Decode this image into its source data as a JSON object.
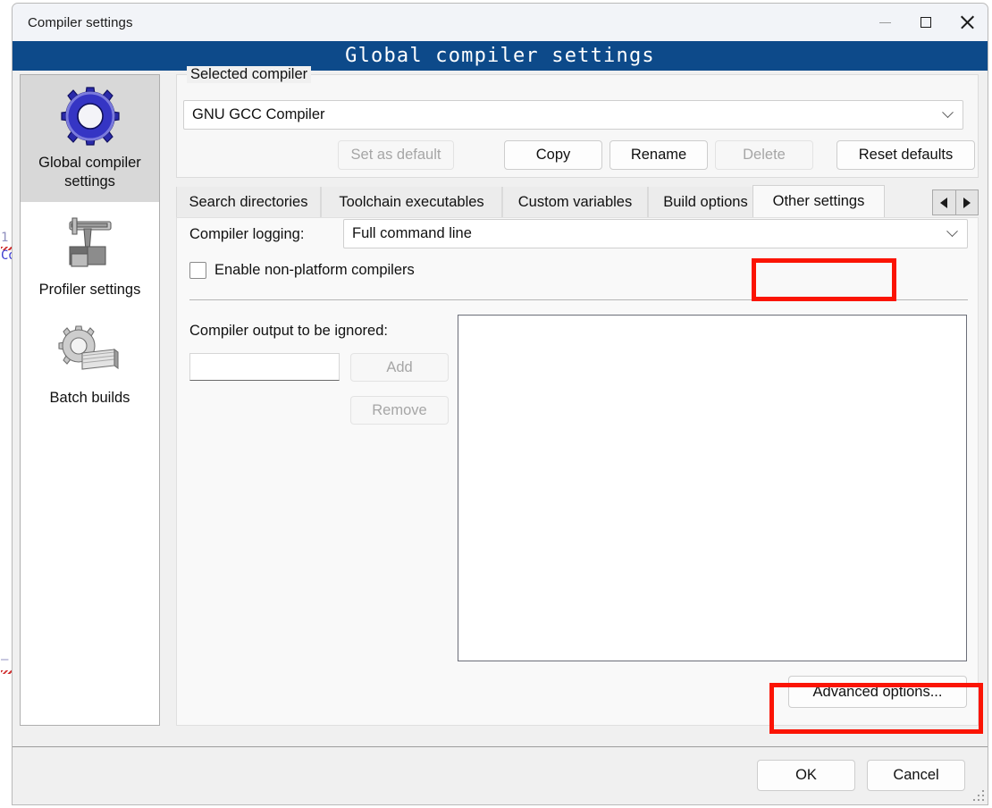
{
  "background_editor": {
    "line_number": "1",
    "code_fragment": "Co"
  },
  "window": {
    "title": "Compiler settings",
    "banner": "Global compiler settings",
    "controls": {
      "minimize": "minimize-icon",
      "maximize": "maximize-icon",
      "close": "close-icon"
    }
  },
  "sidebar": {
    "items": [
      {
        "label": "Global compiler settings",
        "icon": "blue-gear-icon",
        "selected": true
      },
      {
        "label": "Profiler settings",
        "icon": "caliper-blocks-icon",
        "selected": false
      },
      {
        "label": "Batch builds",
        "icon": "gear-stack-icon",
        "selected": false
      }
    ]
  },
  "selected_compiler": {
    "legend": "Selected compiler",
    "combo_value": "GNU GCC Compiler",
    "combo_icon": "chevron-down-icon",
    "buttons": [
      {
        "label": "Set as default",
        "disabled": true
      },
      {
        "label": "Copy",
        "disabled": false
      },
      {
        "label": "Rename",
        "disabled": false
      },
      {
        "label": "Delete",
        "disabled": true
      },
      {
        "label": "Reset defaults",
        "disabled": false
      }
    ]
  },
  "tabs": {
    "items": [
      {
        "label": "Search directories",
        "active": false
      },
      {
        "label": "Toolchain executables",
        "active": false
      },
      {
        "label": "Custom variables",
        "active": false
      },
      {
        "label": "Build options",
        "active": false
      },
      {
        "label": "Other settings",
        "active": true
      }
    ],
    "scroll_left_icon": "triangle-left-icon",
    "scroll_right_icon": "triangle-right-icon"
  },
  "other_settings": {
    "logging_label": "Compiler logging:",
    "logging_value": "Full command line",
    "logging_icon": "chevron-down-icon",
    "enable_non_platform_label": "Enable non-platform compilers",
    "enable_non_platform_checked": false,
    "ignored_label": "Compiler output to be ignored:",
    "ignored_input_value": "",
    "ignored_input_placeholder": "",
    "add_label": "Add",
    "add_disabled": true,
    "remove_label": "Remove",
    "remove_disabled": true,
    "ignored_list_items": [],
    "advanced_label": "Advanced options..."
  },
  "footer": {
    "ok_label": "OK",
    "cancel_label": "Cancel",
    "grip_icon": "resize-grip-icon"
  },
  "annotations": {
    "highlight_color": "#fb1404",
    "boxes": [
      "other-settings-tab",
      "advanced-options-button"
    ]
  }
}
